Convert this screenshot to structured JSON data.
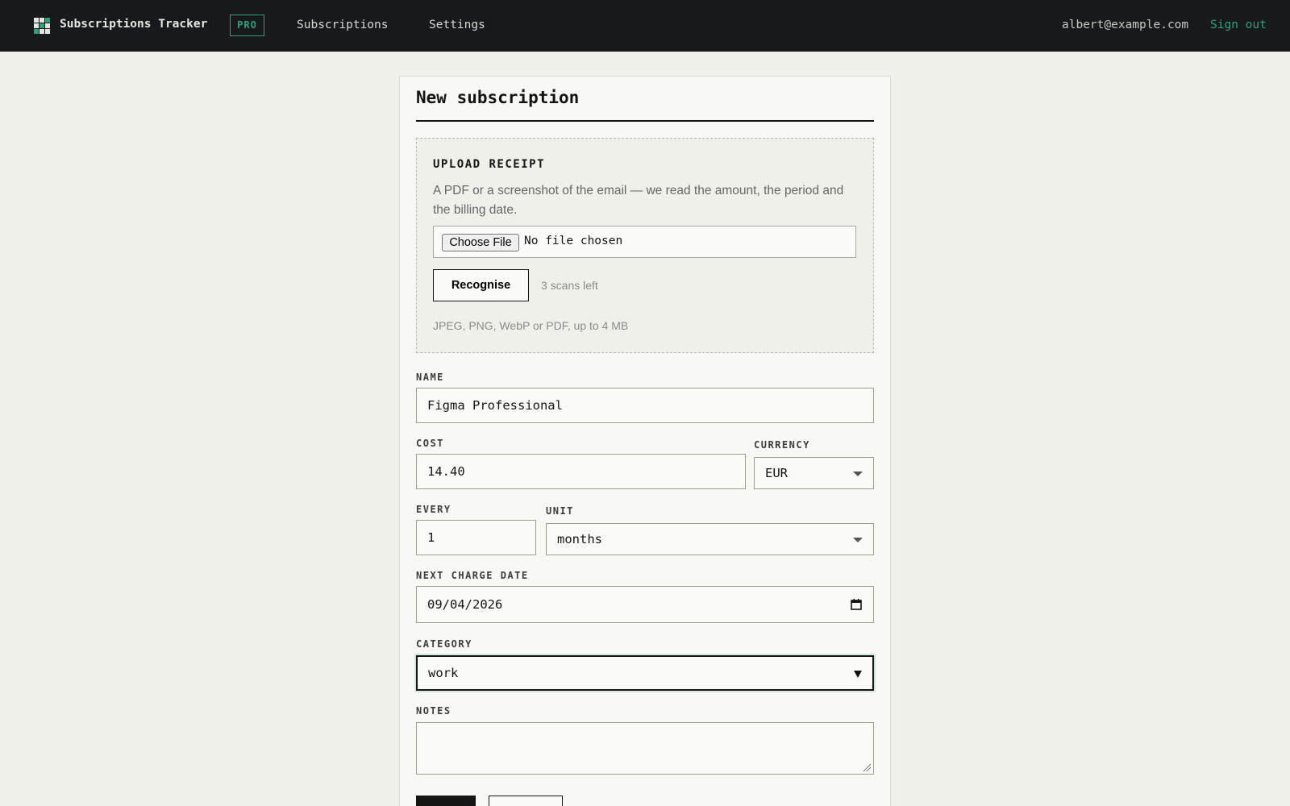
{
  "header": {
    "brand": "Subscriptions Tracker",
    "badge": "PRO",
    "nav": [
      {
        "label": "Subscriptions"
      },
      {
        "label": "Settings"
      }
    ],
    "user_email": "albert@example.com",
    "sign_out": "Sign out"
  },
  "form": {
    "title": "New subscription",
    "upload": {
      "title": "UPLOAD RECEIPT",
      "description": "A PDF or a screenshot of the email — we read the amount, the period and the billing date.",
      "choose_button": "Choose File",
      "file_status": "No file chosen",
      "recognise_button": "Recognise",
      "scans_left": "3 scans left",
      "formats": "JPEG, PNG, WebP or PDF, up to 4 MB"
    },
    "name": {
      "label": "NAME",
      "value": "Figma Professional"
    },
    "cost": {
      "label": "COST",
      "value": "14.40"
    },
    "currency": {
      "label": "CURRENCY",
      "value": "EUR"
    },
    "every": {
      "label": "EVERY",
      "value": "1"
    },
    "unit": {
      "label": "UNIT",
      "value": "months"
    },
    "next_charge_date": {
      "label": "NEXT CHARGE DATE",
      "value": "09/04/2026"
    },
    "category": {
      "label": "CATEGORY",
      "value": "work"
    },
    "notes": {
      "label": "NOTES",
      "value": ""
    }
  },
  "colors": {
    "topbar": "#17191c",
    "accent": "#2fa07a",
    "background": "#f1f1ec",
    "card": "#f8f8f5"
  },
  "icons": [
    "grid-logo-icon",
    "chevron-down-icon",
    "calendar-icon",
    "resize-grip-icon"
  ]
}
